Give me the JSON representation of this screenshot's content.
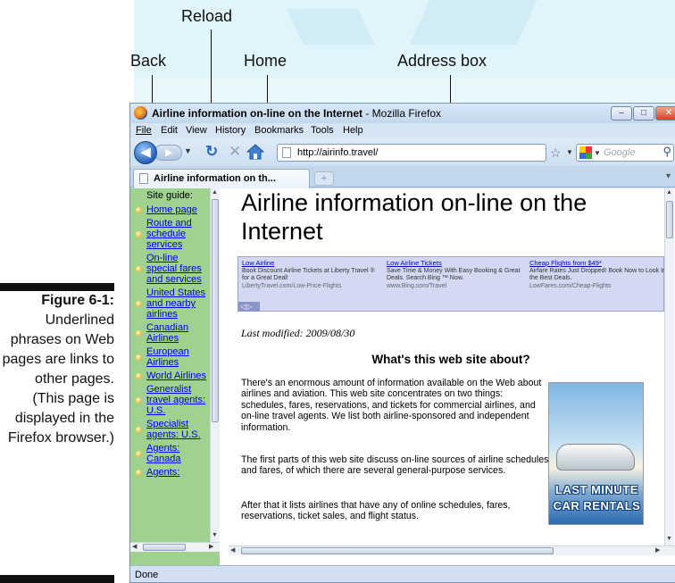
{
  "callouts": {
    "reload": "Reload",
    "back": "Back",
    "home": "Home",
    "address_box": "Address box"
  },
  "caption": {
    "title": "Figure 6-1:",
    "text": "Underlined phrases on Web pages are links to other pages. (This page is displayed in the Firefox browser.)"
  },
  "window": {
    "title_bold": "Airline information on-line on the Internet",
    "title_suffix": " - Mozilla Firefox",
    "controls": {
      "minimize": "–",
      "maximize": "□",
      "close": "✕"
    }
  },
  "menu": [
    "File",
    "Edit",
    "View",
    "History",
    "Bookmarks",
    "Tools",
    "Help"
  ],
  "nav": {
    "address_url": "http://airinfo.travel/",
    "search_placeholder": "Google"
  },
  "tabs": {
    "active_label": "Airline information on th...",
    "new_tab": "+"
  },
  "left_frame": {
    "heading": "Site guide:",
    "items": [
      "Home page",
      "Route and schedule services",
      "On-line special fares and services",
      "United States and nearby airlines",
      "Canadian Airlines",
      "European Airlines",
      "World Airlines",
      "Generalist travel agents: U.S.",
      "Specialist agents: U.S.",
      "Agents: Canada",
      "Agents:"
    ]
  },
  "page": {
    "h1": "Airline information on-line on the Internet",
    "ads": [
      {
        "title": "Low Airline",
        "body": "Book Discount Airline Tickets at Liberty Travel ® for a Great Deal!",
        "url": "LibertyTravel.com/Low-Price-Flights"
      },
      {
        "title": "Low Airline Tickets",
        "body": "Save Time & Money With Easy Booking & Great Deals. Search Bing ™ Now.",
        "url": "www.Bing.com/Travel"
      },
      {
        "title": "Cheap Flights from $49*",
        "body": "Airfare Rates Just Dropped! Book Now to Look In the Best Deals.",
        "url": "LowFares.com/Cheap-Flights"
      }
    ],
    "ad_nav": "◁▷",
    "last_modified": "Last modified: 2009/08/30",
    "h2": "What's this web site about?",
    "paragraphs": [
      "There's an enormous amount of information available on the Web about airlines and aviation. This web site concentrates on two things: schedules, fares, reservations, and tickets for commercial airlines, and on-line travel agents. We list both airline-sponsored and independent information.",
      "The first parts of this web site discuss on-line sources of airline schedules and fares, of which there are several general-purpose services.",
      "After that it lists airlines that have any of online schedules, fares, reservations, ticket sales, and flight status."
    ],
    "promo": [
      "LAST MINUTE",
      "CAR RENTALS"
    ]
  },
  "status": "Done"
}
